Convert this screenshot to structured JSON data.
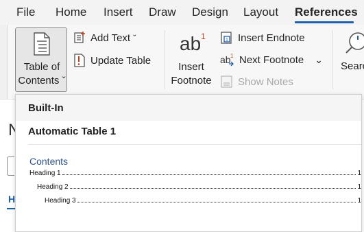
{
  "menu": {
    "tabs": [
      "File",
      "Home",
      "Insert",
      "Draw",
      "Design",
      "Layout",
      "References"
    ],
    "active": "References"
  },
  "ribbon": {
    "toc_button": {
      "line1": "Table of",
      "line2": "Contents",
      "chevron": "ˇ"
    },
    "add_text": {
      "label": "Add Text",
      "chevron": "ˇ"
    },
    "update_table": {
      "label": "Update Table"
    },
    "insert_footnote": {
      "icon_text": "ab",
      "superscript": "1",
      "line1": "Insert",
      "line2": "Footnote"
    },
    "insert_endnote": {
      "label": "Insert Endnote"
    },
    "next_footnote": {
      "label": "Next Footnote",
      "chevron": "⌄"
    },
    "show_notes": {
      "label": "Show Notes",
      "disabled": true
    },
    "search": {
      "label": "Searc"
    }
  },
  "dropdown": {
    "section_header": "Built-In",
    "gallery_item": "Automatic Table 1",
    "preview": {
      "title": "Contents",
      "entries": [
        {
          "text": "Heading 1",
          "page": "1"
        },
        {
          "text": "Heading 2",
          "page": "1"
        },
        {
          "text": "Heading 3",
          "page": "1"
        }
      ]
    }
  },
  "colors": {
    "accent": "#1b5fad",
    "contents_title": "#2f5496",
    "disabled_text": "#a8a8a8"
  }
}
